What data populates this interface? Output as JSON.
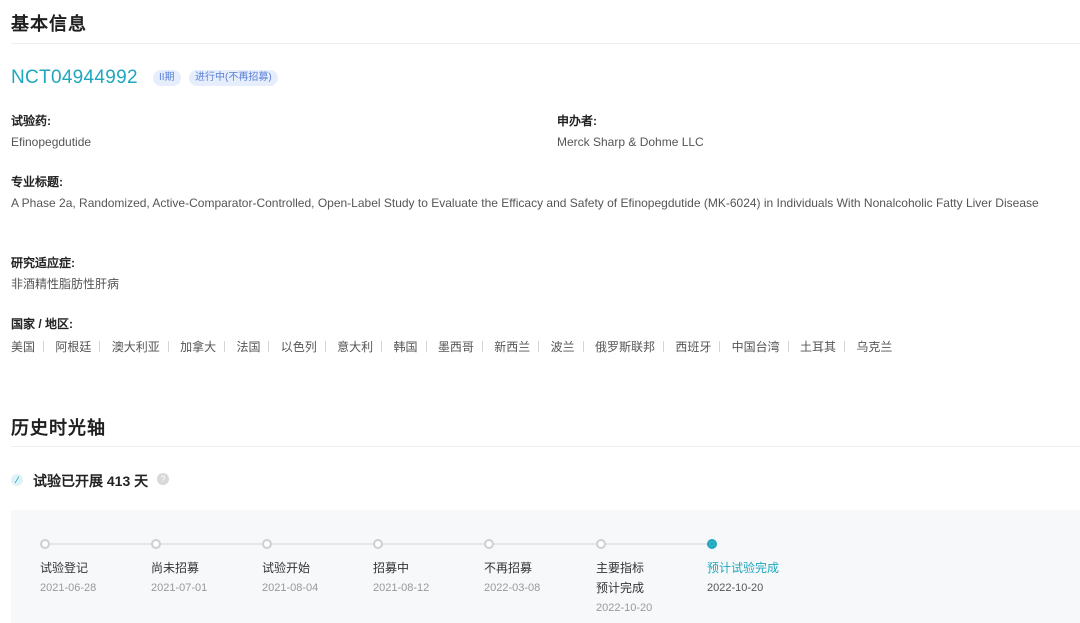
{
  "basic_info": {
    "title": "基本信息",
    "nct_id": "NCT04944992",
    "phase_badge": "II期",
    "status_badge": "进行中(不再招募)",
    "drug_label": "试验药:",
    "drug_value": "Efinopegdutide",
    "sponsor_label": "申办者:",
    "sponsor_value": "Merck Sharp & Dohme LLC",
    "professional_title_label": "专业标题:",
    "professional_title_value": "A Phase 2a, Randomized, Active-Comparator-Controlled, Open-Label Study to Evaluate the Efficacy and Safety of Efinopegdutide (MK-6024) in Individuals With Nonalcoholic Fatty Liver Disease",
    "indication_label": "研究适应症:",
    "indication_value": "非酒精性脂肪性肝病",
    "countries_label": "国家 / 地区:",
    "countries": [
      "美国",
      "阿根廷",
      "澳大利亚",
      "加拿大",
      "法国",
      "以色列",
      "意大利",
      "韩国",
      "墨西哥",
      "新西兰",
      "波兰",
      "俄罗斯联邦",
      "西班牙",
      "中国台湾",
      "土耳其",
      "乌克兰"
    ]
  },
  "history": {
    "title": "历史时光轴",
    "elapsed_text": "试验已开展 413 天",
    "steps": [
      {
        "label": "试验登记",
        "label2": "",
        "date": "2021-06-28",
        "active": false
      },
      {
        "label": "尚未招募",
        "label2": "",
        "date": "2021-07-01",
        "active": false
      },
      {
        "label": "试验开始",
        "label2": "",
        "date": "2021-08-04",
        "active": false
      },
      {
        "label": "招募中",
        "label2": "",
        "date": "2021-08-12",
        "active": false
      },
      {
        "label": "不再招募",
        "label2": "",
        "date": "2022-03-08",
        "active": false
      },
      {
        "label": "主要指标",
        "label2": "预计完成",
        "date": "2022-10-20",
        "active": false
      },
      {
        "label": "预计试验完成",
        "label2": "",
        "date": "2022-10-20",
        "active": true
      }
    ]
  },
  "colors": {
    "accent": "#1fa7be",
    "badge_bg": "#e6eefc",
    "badge_text": "#5b7fd6"
  }
}
